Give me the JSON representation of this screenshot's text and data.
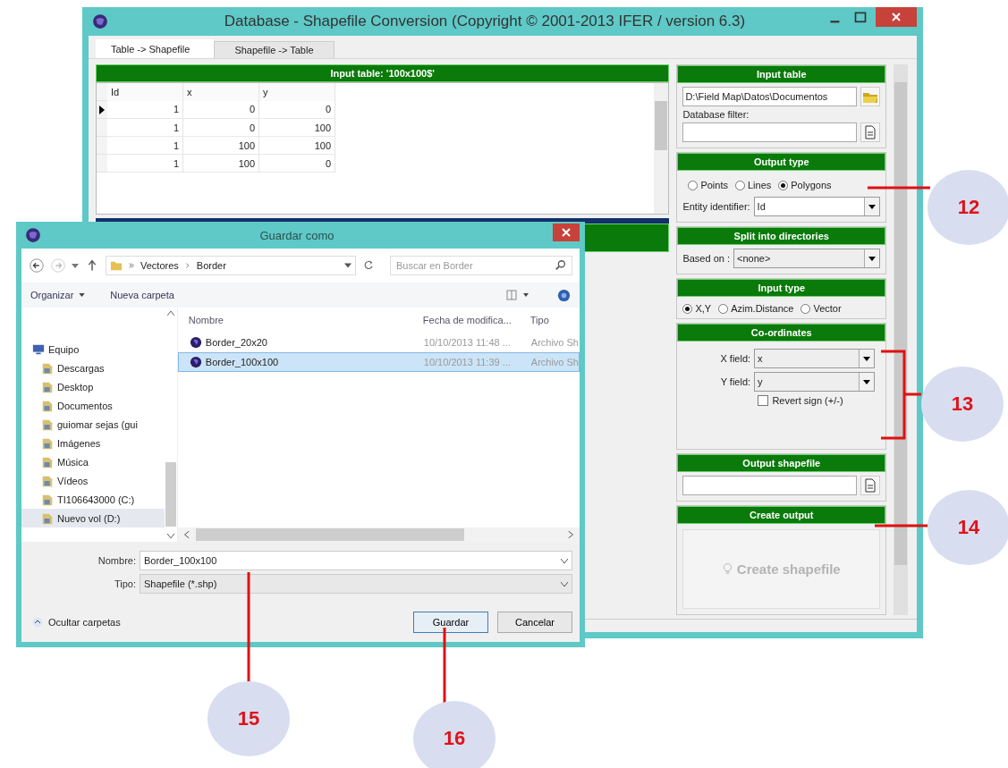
{
  "main_window": {
    "title": "Database - Shapefile Conversion (Copyright © 2001-2013 IFER / version 6.3)",
    "tabs": [
      {
        "label": "Table -> Shapefile",
        "selected": true
      },
      {
        "label": "Shapefile -> Table",
        "selected": false
      }
    ],
    "table": {
      "title": "Input table: '100x100$'",
      "columns": [
        "Id",
        "x",
        "y"
      ],
      "rows": [
        {
          "current": true,
          "cells": [
            "1",
            "0",
            "0"
          ]
        },
        {
          "current": false,
          "cells": [
            "1",
            "0",
            "100"
          ]
        },
        {
          "current": false,
          "cells": [
            "1",
            "100",
            "100"
          ]
        },
        {
          "current": false,
          "cells": [
            "1",
            "100",
            "0"
          ]
        }
      ]
    },
    "panel": {
      "input_table": {
        "title": "Input table",
        "path": "D:\\Field Map\\Datos\\Documentos",
        "filter_label": "Database filter:"
      },
      "output_type": {
        "title": "Output type",
        "options": [
          {
            "label": "Points",
            "selected": false
          },
          {
            "label": "Lines",
            "selected": false
          },
          {
            "label": "Polygons",
            "selected": true
          }
        ],
        "entity_label": "Entity identifier:",
        "entity_value": "Id"
      },
      "split": {
        "title": "Split into directories",
        "label": "Based on :",
        "value": "<none>"
      },
      "input_type": {
        "title": "Input type",
        "options": [
          {
            "label": "X,Y",
            "selected": true
          },
          {
            "label": "Azim.Distance",
            "selected": false
          },
          {
            "label": "Vector",
            "selected": false
          }
        ]
      },
      "coordinates": {
        "title": "Co-ordinates",
        "x_label": "X field:",
        "x_value": "x",
        "y_label": "Y field:",
        "y_value": "y",
        "revert_label": "Revert sign (+/-)",
        "revert_checked": false
      },
      "output_shapefile": {
        "title": "Output shapefile"
      },
      "create_output": {
        "title": "Create output",
        "button": "Create shapefile",
        "disabled": true
      }
    }
  },
  "dialog": {
    "title": "Guardar como",
    "path": [
      "Vectores",
      "Border"
    ],
    "search_placeholder": "Buscar en Border",
    "organize": "Organizar",
    "new_folder": "Nueva carpeta",
    "nav": [
      {
        "label": "Equipo",
        "selected": false,
        "children": [
          {
            "label": "Descargas",
            "selected": false
          },
          {
            "label": "Desktop",
            "selected": false
          },
          {
            "label": "Documentos",
            "selected": false
          },
          {
            "label": "guiomar sejas (gui",
            "selected": false
          },
          {
            "label": "Imágenes",
            "selected": false
          },
          {
            "label": "Música",
            "selected": false
          },
          {
            "label": "Vídeos",
            "selected": false
          },
          {
            "label": "TI106643000 (C:)",
            "selected": false
          },
          {
            "label": "Nuevo vol (D:)",
            "selected": true
          }
        ]
      }
    ],
    "columns": [
      "Nombre",
      "Fecha de modifica...",
      "Tipo"
    ],
    "files": [
      {
        "name": "Border_20x20",
        "date": "10/10/2013 11:48 ...",
        "type": "Archivo Sh",
        "selected": false
      },
      {
        "name": "Border_100x100",
        "date": "10/10/2013 11:39 ...",
        "type": "Archivo Sh",
        "selected": true
      }
    ],
    "name_label": "Nombre:",
    "name_value": "Border_100x100",
    "type_label": "Tipo:",
    "type_value": "Shapefile (*.shp)",
    "hide_folders": "Ocultar carpetas",
    "save": "Guardar",
    "cancel": "Cancelar"
  },
  "callouts": [
    {
      "label": "12"
    },
    {
      "label": "13"
    },
    {
      "label": "14"
    },
    {
      "label": "15"
    },
    {
      "label": "16"
    }
  ]
}
